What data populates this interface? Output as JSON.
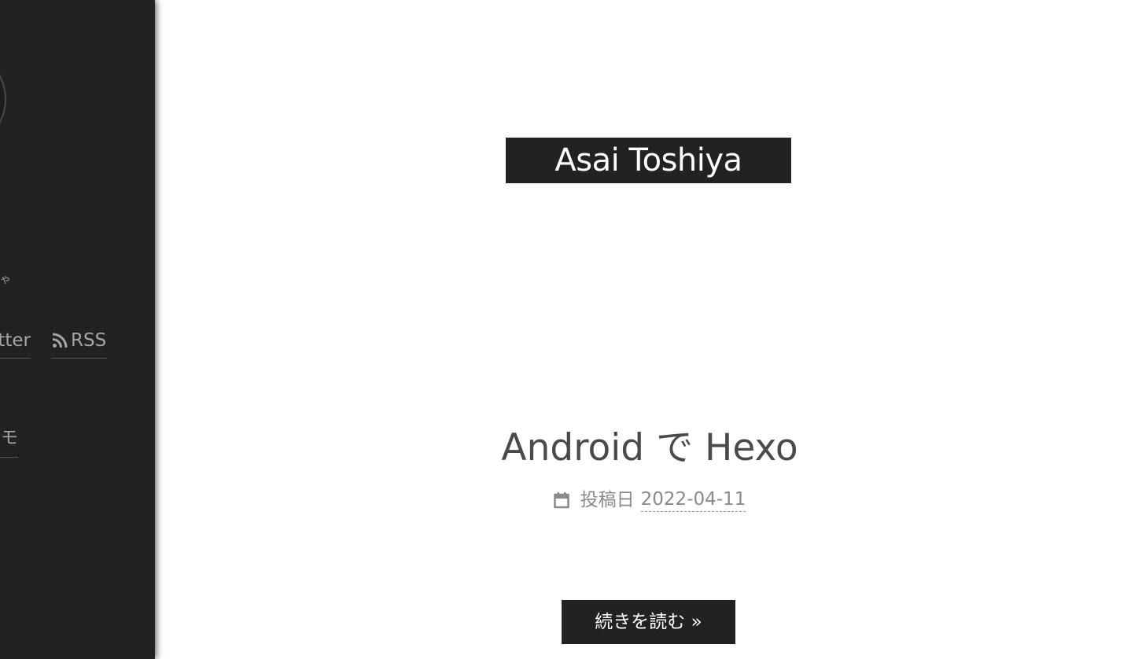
{
  "sidebar": {
    "mark_text": "ゃ",
    "social": {
      "twitter_label": "Twitter",
      "rss_label": "RSS"
    },
    "category_label": "メモ"
  },
  "header": {
    "site_title": "Asai Toshiya"
  },
  "post": {
    "title": "Android で Hexo",
    "meta_label": "投稿日",
    "date": "2022-04-11",
    "read_more": "続きを読む »"
  },
  "icons": {
    "rss": "rss-icon",
    "calendar": "calendar-icon"
  },
  "colors": {
    "sidebar_bg": "#222222",
    "title_bg": "#222222",
    "text_muted": "#8a8a8a",
    "post_title": "#4a4a4a"
  }
}
